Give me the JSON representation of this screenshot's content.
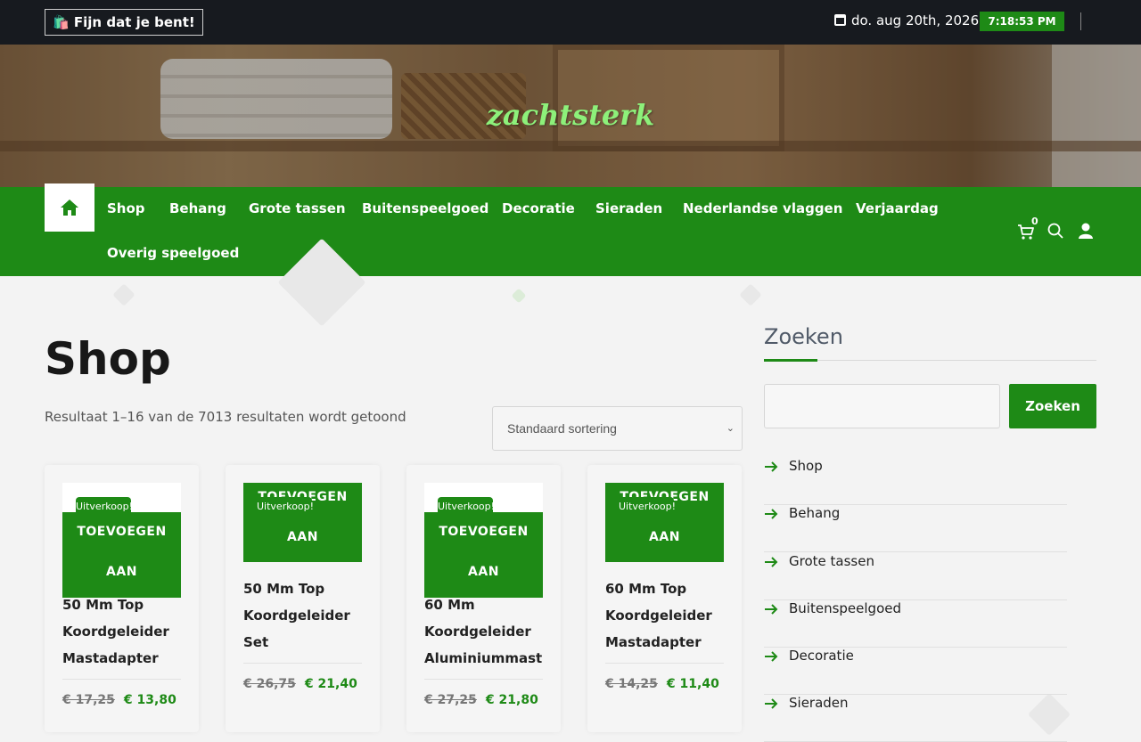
{
  "topbar": {
    "greeting": "🛍️ Fijn dat je bent!",
    "date": "do. aug 20th, 2026",
    "time": "7:18:53 PM"
  },
  "site": {
    "logo": "zachtsterk"
  },
  "nav": {
    "items": [
      "Shop",
      "Behang",
      "Grote tassen",
      "Buitenspeelgoed",
      "Decoratie",
      "Sieraden",
      "Nederlandse vlaggen",
      "Verjaardag",
      "Overig speelgoed"
    ],
    "cart_count": "0",
    "icons": [
      "home-icon",
      "cart-icon",
      "search-icon",
      "user-icon"
    ]
  },
  "main": {
    "title": "Shop",
    "result_count": "Resultaat 1–16 van de 7013 resultaten wordt getoond",
    "sort_selected": "Standaard sortering"
  },
  "products": [
    {
      "sale_badge": "Uitverkoop!",
      "add_line1": "TOEVOEGEN",
      "add_line2": "AAN",
      "name": "50 Mm Top Koordgeleider Mastadapter",
      "old_price": "€ 17,25",
      "new_price": "€ 13,80"
    },
    {
      "sale_badge": "Uitverkoop!",
      "add_line1": "TOEVOEGEN",
      "add_line2": "AAN",
      "name": "50 Mm Top Koordgeleider Set",
      "old_price": "€ 26,75",
      "new_price": "€ 21,40"
    },
    {
      "sale_badge": "Uitverkoop!",
      "add_line1": "TOEVOEGEN",
      "add_line2": "AAN",
      "name": "60 Mm Koordgeleider Aluminiummast",
      "old_price": "€ 27,25",
      "new_price": "€ 21,80"
    },
    {
      "sale_badge": "Uitverkoop!",
      "add_line1": "TOEVOEGEN",
      "add_line2": "AAN",
      "name": "60 Mm Top Koordgeleider Mastadapter",
      "old_price": "€ 14,25",
      "new_price": "€ 11,40"
    }
  ],
  "sidebar": {
    "title": "Zoeken",
    "search_button": "Zoeken",
    "categories": [
      "Shop",
      "Behang",
      "Grote tassen",
      "Buitenspeelgoed",
      "Decoratie",
      "Sieraden"
    ]
  },
  "colors": {
    "accent": "#1e8a16",
    "topbar": "#171a1f",
    "logo": "#8df07a"
  }
}
